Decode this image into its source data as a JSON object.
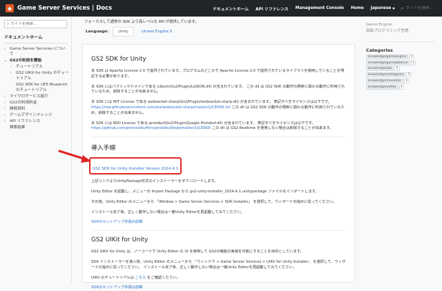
{
  "header": {
    "brand_title": "Game Server Services | Docs",
    "nav_items": [
      "ドキュメントホーム",
      "API リファレンス",
      "Management Console",
      "Home"
    ],
    "language": "Japanese",
    "search_placeholder": "サイトを検索…"
  },
  "sidebar": {
    "search_placeholder": "サイトを検索…",
    "home_label": "ドキュメントホーム",
    "items": [
      {
        "arrow": "›",
        "label": "Game Server Services について",
        "bold": false,
        "indent": 0
      },
      {
        "arrow": "⌄",
        "label": "GS2の利用を開始",
        "bold": true,
        "indent": 0
      },
      {
        "arrow": "›",
        "label": "チュートリアル",
        "bold": false,
        "indent": 1
      },
      {
        "arrow": "›",
        "label": "GS2 UIKit for Unity のチュートリアル",
        "bold": false,
        "indent": 1
      },
      {
        "arrow": "",
        "label": "GS2 SDK for UE5 Blueprint のチュートリアル",
        "bold": false,
        "indent": 1
      },
      {
        "arrow": "›",
        "label": "マイクロサービス紹介",
        "bold": false,
        "indent": 0
      },
      {
        "arrow": "›",
        "label": "GS2の利用料金",
        "bold": false,
        "indent": 0
      },
      {
        "arrow": "›",
        "label": "開発資料",
        "bold": false,
        "indent": 0
      },
      {
        "arrow": "›",
        "label": "ゲームデザインナレッジ",
        "bold": false,
        "indent": 0
      },
      {
        "arrow": "›",
        "label": "API リファレンス",
        "bold": false,
        "indent": 0
      },
      {
        "arrow": "",
        "label": "検索結果",
        "bold": false,
        "indent": 0
      }
    ]
  },
  "main": {
    "intro_text": "フォーカスして通常の SDK より高レベルな API が提供しています。",
    "language_label": "Language:",
    "tabs": [
      "Unity",
      "Unreal Engine 5"
    ],
    "section1": {
      "title": "GS2 SDK for Unity",
      "p1": "本 SDK は Apache License 2.0 で提供されています。プログラムのどこかで Apache License 2.0 で提供されているライブラリを使用していることを明記する必要があります。",
      "p2": "本 SDK にはパブリックドメインである LitJson(Gs2/Plugin/LitJSON.dll) が含まれています。 この dll は GS2 SDK の動作の根幹に関わる動作に利用されているため、削除することが出来ません。",
      "p3_before": "本 SDK には MIT License である websocket-sharp(Gs2/Plugin/websocket-sharp.dll) が含まれています。 表記すべきライセンスは以下です。 ",
      "p3_link": "https://raw.githubusercontent.com/sta/websocket-sharp/master/LICENSE.txt",
      "p3_after": " この dll は GS2 SDK の動作の根幹に関わる動作に利用されているため、削除することが出来ません。",
      "p4_before": "本 SDK には BSD License である protobuf(Gs2/Plugin/Google.Protobuf.dll) が含まれています。 表記すべきライセンスは以下です。 ",
      "p4_link": "https://github.com/protocolbuffers/protobuf/blob/master/LICENSE",
      "p4_after": " この dll は GS2-Realtime を使用しない場合は削除することが出来ます。"
    },
    "install": {
      "title": "導入手順",
      "button_label": "GS2 SDK for Unity Installer Version 2024.4.1",
      "p1": "上記リンクよりUnityPackage形式のインストーラーをダウンロードします。",
      "p2": "Unity Editor を起動し、メニューの Import Package から gs2-unity-installer_2024.4.1.unitypackage ファイルをインポートします。",
      "p3": "その後、Unity Editor のメニューから 「Window > Game Server Services > SDK Installer」 を選択して、ウィザードの指示に従ってください。",
      "p4": "インストール完了後、正しく動作しない場合は一度Unity Editorを再起動してみてください。",
      "setup_link": "SDKのセットアップ手順の詳細"
    },
    "uikit": {
      "title": "GS2 UIKit for Unity",
      "p1": "GS2 UIKit for Unity は、ノーコードで Unity Editor の UI を使用して GS2の機能の実装を可能にすることを目的としています。",
      "p2": "SDK インストーラーを導入後、Unity Editor のメニューから 『ウィンドウ > Game Server Services > UIKit for Unity Installer』 を選択して、ウィザードの指示に従ってください。 インストール完了後、正しく動作しない場合は一度Unity Editorを再起動してみてください。",
      "p3_before": "UIKit のチュートリアルは ",
      "p3_link": "こちら",
      "p3_after": " をご確認ください。",
      "setup_link": "SDKのセットアップ手順の詳細"
    }
  },
  "right": {
    "game_engine": "Game Engine",
    "subtitle": "高級プログラミング言語",
    "categories_title": "Categories",
    "tags": [
      {
        "label": "knowledge/gameengine",
        "count": "4"
      },
      {
        "label": "knowledge/gamebalance",
        "count": "1"
      },
      {
        "label": "knowledge/law",
        "count": "2"
      },
      {
        "label": "knowledge/metagame",
        "count": "5"
      },
      {
        "label": "knowledge/monetize",
        "count": "3"
      },
      {
        "label": "knowledge/safety",
        "count": "1"
      }
    ]
  },
  "colors": {
    "accent": "#e35a25",
    "link": "#2b70c9",
    "highlight": "#e02424",
    "header_bg": "#212529"
  }
}
